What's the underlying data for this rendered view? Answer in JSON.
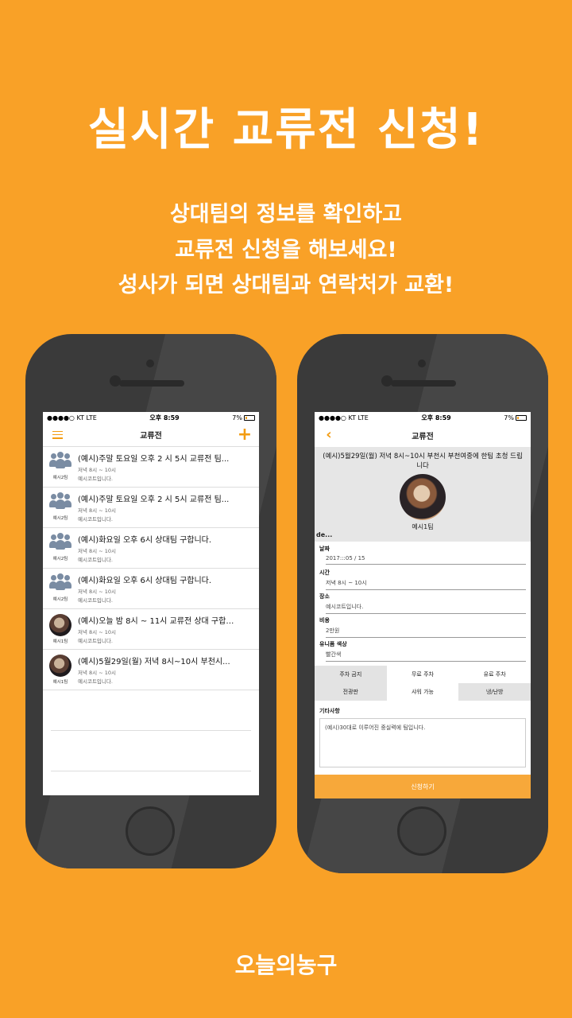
{
  "headline": "실시간 교류전 신청!",
  "sublines": [
    "상대팀의 정보를 확인하고",
    "교류전 신청을 해보세요!",
    "성사가 되면 상대팀과 연락처가 교환!"
  ],
  "brand": "오늘의농구",
  "status": {
    "carrier": "●●●●○ KT  LTE",
    "time": "오후 8:59",
    "battery": "7%"
  },
  "list_screen": {
    "title": "교류전",
    "items": [
      {
        "title": "(예시)주말 토요일 오후 2 시 5시 교류전 팀...",
        "time": "저녁 8시 ~ 10시",
        "place": "예시코트입니다.",
        "team": "예시2팀",
        "avatar": "team-icon"
      },
      {
        "title": "(예시)주말 토요일 오후 2 시 5시 교류전 팀...",
        "time": "저녁 8시 ~ 10시",
        "place": "예시코트입니다.",
        "team": "예시2팀",
        "avatar": "team-icon"
      },
      {
        "title": "(예시)화요일 오후 6시 상대팀 구합니다.",
        "time": "저녁 8시 ~ 10시",
        "place": "예시코트입니다.",
        "team": "예시2팀",
        "avatar": "team-icon"
      },
      {
        "title": "(예시)화요일 오후 6시 상대팀 구합니다.",
        "time": "저녁 8시 ~ 10시",
        "place": "예시코트입니다.",
        "team": "예시2팀",
        "avatar": "team-icon"
      },
      {
        "title": "(예시)오늘 밤 8시 ~ 11시 교류전 상대 구합…",
        "time": "저녁 8시 ~ 10시",
        "place": "예시코트입니다.",
        "team": "예시1팀",
        "avatar": "dog-photo"
      },
      {
        "title": "(예시)5월29일(월) 저녁 8시~10시 부천시...",
        "time": "저녁 8시 ~ 10시",
        "place": "예시코트입니다.",
        "team": "예시1팀",
        "avatar": "dog-photo"
      }
    ]
  },
  "detail_screen": {
    "title": "교류전",
    "description": "(예시)5월29일(월) 저녁 8시~10시 부천시 부천여중에 한팀 초청 드립니다",
    "team": "예시1팀",
    "de": "de...",
    "fields": [
      {
        "label": "날짜",
        "value": "2017:::05 / 15"
      },
      {
        "label": "시간",
        "value": "저녁 8시 ~ 10시"
      },
      {
        "label": "장소",
        "value": "예시코트입니다."
      },
      {
        "label": "비용",
        "value": "2만원"
      },
      {
        "label": "유니폼 색상",
        "value": "빨간색"
      }
    ],
    "options": [
      {
        "label": "주차 금지",
        "selected": true
      },
      {
        "label": "무료 주차",
        "selected": false
      },
      {
        "label": "유료 주차",
        "selected": false
      },
      {
        "label": "전광판",
        "selected": true
      },
      {
        "label": "샤워 가능",
        "selected": false
      },
      {
        "label": "냉/난방",
        "selected": true
      }
    ],
    "etc_label": "기타사항",
    "etc_text": "(예시)30대로 이루어진 중실력에 팀입니다.",
    "apply_label": "신청하기"
  },
  "colors": {
    "background": "#F9A127",
    "accent": "#F39C12",
    "phone": "#3A3A3A"
  }
}
